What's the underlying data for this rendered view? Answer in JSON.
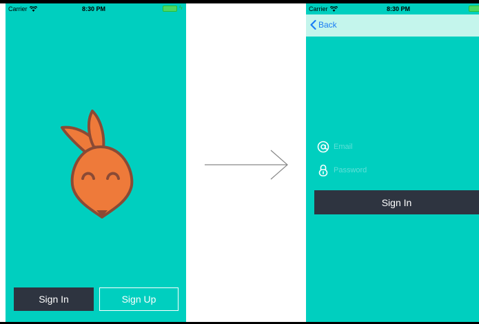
{
  "status_bar": {
    "carrier": "Carrier",
    "time": "8:30 PM"
  },
  "welcome_screen": {
    "sign_in_label": "Sign In",
    "sign_up_label": "Sign Up",
    "mascot_icon": "fox-mascot-icon"
  },
  "login_screen": {
    "back_label": "Back",
    "email_placeholder": "Email",
    "password_placeholder": "Password",
    "sign_in_label": "Sign In"
  },
  "colors": {
    "background": "#00cfbf",
    "nav_bar": "#c4f5ec",
    "button_dark": "#2e3440",
    "mascot_fill": "#ee7a3a",
    "mascot_outline": "#8a4a35",
    "back_link": "#1a7cf5"
  }
}
